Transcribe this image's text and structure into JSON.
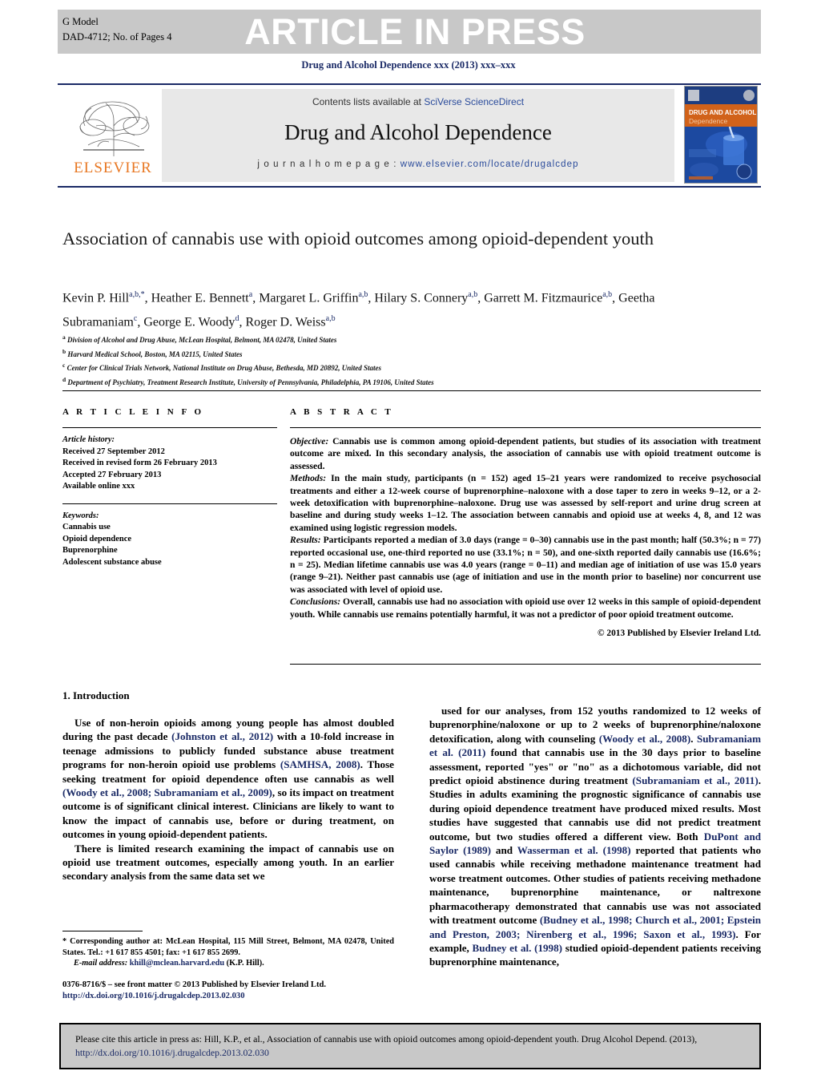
{
  "banner": {
    "g_model": "G Model",
    "article_id": "DAD-4712;   No. of Pages 4",
    "press_label": "ARTICLE IN PRESS"
  },
  "journal_ref": "Drug and Alcohol Dependence xxx (2013) xxx–xxx",
  "masthead": {
    "contents_prefix": "Contents lists available at ",
    "contents_link": "SciVerse ScienceDirect",
    "journal_name": "Drug and Alcohol Dependence",
    "homepage_label": "j o u r n a l   h o m e p a g e :  ",
    "homepage_url": "www.elsevier.com/locate/drugalcdep",
    "publisher_wordmark": "ELSEVIER",
    "cover_title_line1": "DRUG AND ALCOHOL",
    "cover_title_line2": "Dependence"
  },
  "article": {
    "title": "Association of cannabis use with opioid outcomes among opioid-dependent youth",
    "authors_html": "Kevin P. Hill<sup>a,b,*</sup>, Heather E. Bennett<sup>a</sup>, Margaret L. Griffin<sup>a,b</sup>, Hilary S. Connery<sup>a,b</sup>, Garrett M. Fitzmaurice<sup>a,b</sup>, Geetha Subramaniam<sup>c</sup>, George E. Woody<sup>d</sup>, Roger D. Weiss<sup>a,b</sup>",
    "affiliations": [
      "Division of Alcohol and Drug Abuse, McLean Hospital, Belmont, MA 02478, United States",
      "Harvard Medical School, Boston, MA 02115, United States",
      "Center for Clinical Trials Network, National Institute on Drug Abuse, Bethesda, MD 20892, United States",
      "Department of Psychiatry, Treatment Research Institute, University of Pennsylvania, Philadelphia, PA 19106, United States"
    ],
    "affiliation_marks": [
      "a",
      "b",
      "c",
      "d"
    ]
  },
  "article_info": {
    "heading": "A R T I C L E    I N F O",
    "history_label": "Article history:",
    "history": [
      "Received 27 September 2012",
      "Received in revised form 26 February 2013",
      "Accepted 27 February 2013",
      "Available online xxx"
    ],
    "keywords_label": "Keywords:",
    "keywords": [
      "Cannabis use",
      "Opioid dependence",
      "Buprenorphine",
      "Adolescent substance abuse"
    ]
  },
  "abstract": {
    "heading": "A B S T R A C T",
    "objective_label": "Objective:",
    "objective_text": " Cannabis use is common among opioid-dependent patients, but studies of its association with treatment outcome are mixed. In this secondary analysis, the association of cannabis use with opioid treatment outcome is assessed.",
    "methods_label": "Methods:",
    "methods_text": " In the main study, participants (n = 152) aged 15–21 years were randomized to receive psychosocial treatments and either a 12-week course of buprenorphine–naloxone with a dose taper to zero in weeks 9–12, or a 2-week detoxification with buprenorphine–naloxone. Drug use was assessed by self-report and urine drug screen at baseline and during study weeks 1–12. The association between cannabis and opioid use at weeks 4, 8, and 12 was examined using logistic regression models.",
    "results_label": "Results:",
    "results_text": " Participants reported a median of 3.0 days (range = 0–30) cannabis use in the past month; half (50.3%; n = 77) reported occasional use, one-third reported no use (33.1%; n = 50), and one-sixth reported daily cannabis use (16.6%; n = 25). Median lifetime cannabis use was 4.0 years (range = 0–11) and median age of initiation of use was 15.0 years (range 9–21). Neither past cannabis use (age of initiation and use in the month prior to baseline) nor concurrent use was associated with level of opioid use.",
    "conclusions_label": "Conclusions:",
    "conclusions_text": " Overall, cannabis use had no association with opioid use over 12 weeks in this sample of opioid-dependent youth. While cannabis use remains potentially harmful, it was not a predictor of poor opioid treatment outcome.",
    "copyright": "© 2013 Published by Elsevier Ireland Ltd."
  },
  "body": {
    "section_heading": "1.  Introduction",
    "left_paragraphs": [
      "Use of non-heroin opioids among young people has almost doubled during the past decade (Johnston et al., 2012) with a 10-fold increase in teenage admissions to publicly funded substance abuse treatment programs for non-heroin opioid use problems (SAMHSA, 2008). Those seeking treatment for opioid dependence often use cannabis as well (Woody et al., 2008; Subramaniam et al., 2009), so its impact on treatment outcome is of significant clinical interest. Clinicians are likely to want to know the impact of cannabis use, before or during treatment, on outcomes in young opioid-dependent patients.",
      "There is limited research examining the impact of cannabis use on opioid use treatment outcomes, especially among youth. In an earlier secondary analysis from the same data set we"
    ],
    "right_paragraphs": [
      "used for our analyses, from 152 youths randomized to 12 weeks of buprenorphine/naloxone or up to 2 weeks of buprenorphine/naloxone detoxification, along with counseling (Woody et al., 2008). Subramaniam et al. (2011) found that cannabis use in the 30 days prior to baseline assessment, reported \"yes\" or \"no\" as a dichotomous variable, did not predict opioid abstinence during treatment (Subramaniam et al., 2011). Studies in adults examining the prognostic significance of cannabis use during opioid dependence treatment have produced mixed results. Most studies have suggested that cannabis use did not predict treatment outcome, but two studies offered a different view. Both DuPont and Saylor (1989) and Wasserman et al. (1998) reported that patients who used cannabis while receiving methadone maintenance treatment had worse treatment outcomes. Other studies of patients receiving methadone maintenance, buprenorphine maintenance, or naltrexone pharmacotherapy demonstrated that cannabis use was not associated with treatment outcome (Budney et al., 1998; Church et al., 2001; Epstein and Preston, 2003; Nirenberg et al., 1996; Saxon et al., 1993). For example, Budney et al. (1998) studied opioid-dependent patients receiving buprenorphine maintenance,"
    ]
  },
  "footnote": {
    "corresponding": "* Corresponding author at: McLean Hospital, 115 Mill Street, Belmont, MA 02478, United States. Tel.: +1 617 855 4501; fax: +1 617 855 2699.",
    "email_label": "E-mail address:",
    "email": "khill@mclean.harvard.edu",
    "email_attrib": "(K.P. Hill).",
    "issn_line": "0376-8716/$ – see front matter © 2013 Published by Elsevier Ireland Ltd.",
    "doi_url": "http://dx.doi.org/10.1016/j.drugalcdep.2013.02.030"
  },
  "cite_box": {
    "text_before": "Please cite this article in press as: Hill, K.P., et al., Association of cannabis use with opioid outcomes among opioid-dependent youth. Drug Alcohol Depend. (2013), ",
    "doi_url": "http://dx.doi.org/10.1016/j.drugalcdep.2013.02.030"
  },
  "colors": {
    "banner_grey": "#c8c8c8",
    "navy": "#1a2a66",
    "link_blue": "#2a4b9b",
    "elsevier_orange": "#e87722",
    "panel_grey": "#e8e8e8"
  }
}
